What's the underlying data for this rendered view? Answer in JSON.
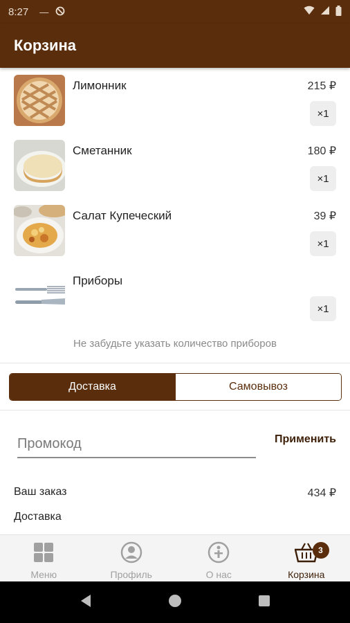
{
  "status_bar": {
    "time": "8:27"
  },
  "header": {
    "title": "Корзина"
  },
  "cart": {
    "items": [
      {
        "name": "Лимонник",
        "price": "215 ₽",
        "qty": "×1",
        "image": "lemon-pie-photo"
      },
      {
        "name": "Сметанник",
        "price": "180 ₽",
        "qty": "×1",
        "image": "sour-cream-cake-photo"
      },
      {
        "name": "Салат Купеческий",
        "price": "39 ₽",
        "qty": "×1",
        "image": "salad-photo"
      },
      {
        "name": "Приборы",
        "price": "",
        "qty": "×1",
        "image": "cutlery-photo"
      }
    ],
    "note": "Не забудьте указать количество приборов"
  },
  "delivery_toggle": {
    "options": [
      "Доставка",
      "Самовывоз"
    ],
    "selected": "Доставка"
  },
  "promo": {
    "placeholder": "Промокод",
    "apply_label": "Применить"
  },
  "summary": {
    "order_label": "Ваш заказ",
    "order_value": "434 ₽",
    "delivery_label": "Доставка"
  },
  "bottom_nav": {
    "items": [
      {
        "label": "Меню",
        "icon": "grid-icon"
      },
      {
        "label": "Профиль",
        "icon": "profile-icon"
      },
      {
        "label": "О нас",
        "icon": "info-icon"
      },
      {
        "label": "Корзина",
        "icon": "basket-icon",
        "badge": "3",
        "active": true
      }
    ]
  },
  "colors": {
    "primary": "#5a2d0c",
    "accent_text": "#3d1f08",
    "inactive_nav": "#a0a0a0"
  }
}
